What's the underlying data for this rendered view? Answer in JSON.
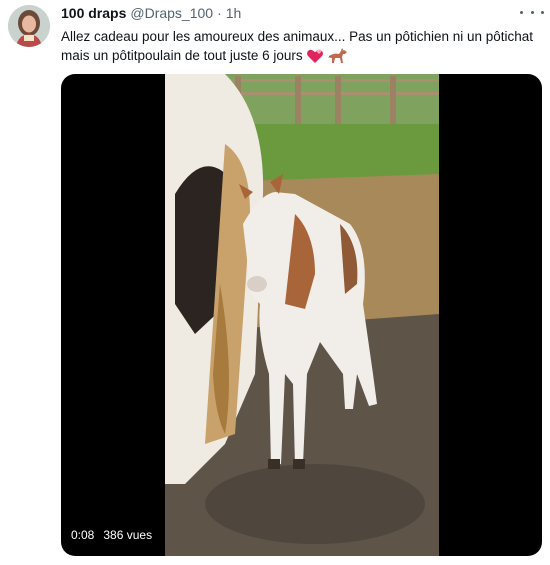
{
  "tweet": {
    "display_name": "100 draps",
    "handle": "@Draps_100",
    "separator": "·",
    "time": "1h",
    "text_line1": "Allez cadeau pour les amoureux des animaux... Pas un pôtichien ni un pôtichat",
    "text_line2": "mais un pôtitpoulain de tout juste 6 jours",
    "emojis": [
      "revolving-hearts",
      "horse"
    ]
  },
  "video": {
    "duration": "0:08",
    "views": "386 vues"
  },
  "colors": {
    "text_primary": "#0f1419",
    "text_secondary": "#536471",
    "video_background": "#000000"
  }
}
